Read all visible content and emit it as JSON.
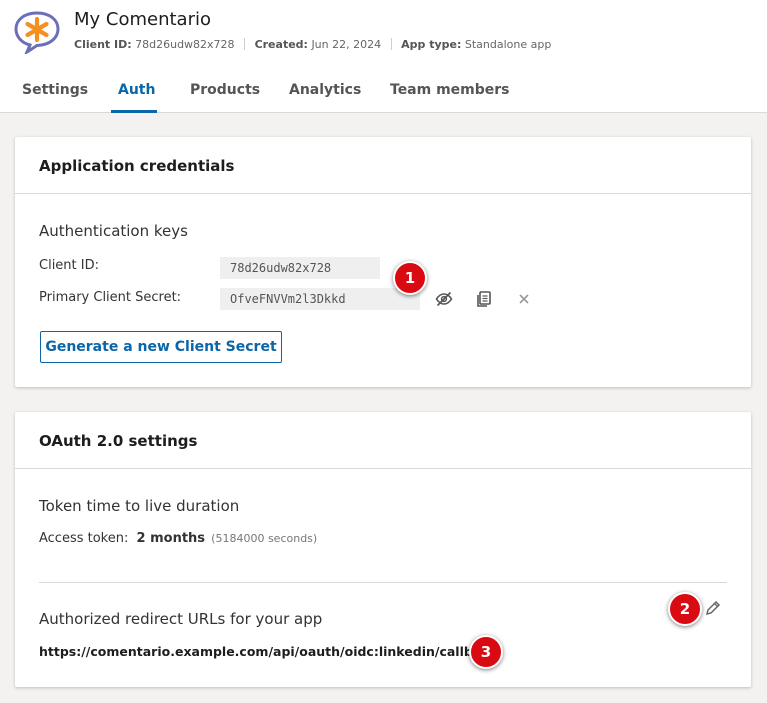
{
  "app": {
    "name": "My Comentario",
    "meta": [
      {
        "key": "Client ID:",
        "value": "78d26udw82x728"
      },
      {
        "key": "Created:",
        "value": "Jun 22, 2024"
      },
      {
        "key": "App type:",
        "value": "Standalone app"
      }
    ]
  },
  "tabs": [
    "Settings",
    "Auth",
    "Products",
    "Analytics",
    "Team members"
  ],
  "active_tab": "Auth",
  "credentials": {
    "title": "Application credentials",
    "section": "Authentication keys",
    "client_id_label": "Client ID:",
    "client_id_value": "78d26udw82x728",
    "secret_label": "Primary Client Secret:",
    "secret_value": "OfveFNVVm2l3Dkkd",
    "generate_button": "Generate a new Client Secret"
  },
  "oauth": {
    "title": "OAuth 2.0 settings",
    "ttl_section": "Token time to live duration",
    "access_token_label": "Access token:",
    "access_token_value": "2 months",
    "access_token_seconds": "(5184000 seconds)",
    "redirect_section": "Authorized redirect URLs for your app",
    "redirect_url": "https://comentario.example.com/api/oauth/oidc:linkedin/callback"
  },
  "badges": [
    "1",
    "2",
    "3"
  ],
  "icons": {
    "hide_secret": "eye-off-icon",
    "copy_secret": "copy-icon",
    "delete_secret": "close-icon",
    "edit_redirect": "pencil-icon",
    "logo": "speech-bubble-asterisk-logo"
  },
  "colors": {
    "accent": "#0a66a8",
    "badge": "#d90a12",
    "logo_bubble": "#6b6fb8",
    "logo_asterisk": "#f39020"
  }
}
